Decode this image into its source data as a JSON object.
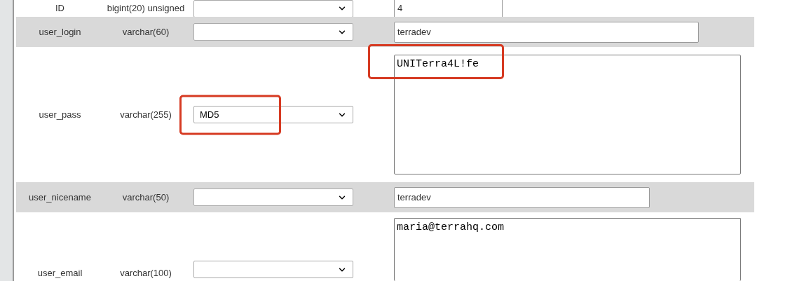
{
  "rows": [
    {
      "column": "ID",
      "type": "bigint(20) unsigned",
      "value": "4",
      "kind": "input",
      "shaded": false,
      "highlight_function": false,
      "highlight_value": false
    },
    {
      "column": "user_login",
      "type": "varchar(60)",
      "value": "terradev",
      "kind": "input",
      "shaded": true,
      "highlight_function": false,
      "highlight_value": false
    },
    {
      "column": "user_pass",
      "type": "varchar(255)",
      "function": "MD5",
      "value": "UNITerra4L!fe",
      "kind": "textarea",
      "shaded": false,
      "highlight_function": true,
      "highlight_value": true
    },
    {
      "column": "user_nicename",
      "type": "varchar(50)",
      "value": "terradev",
      "kind": "input",
      "shaded": true,
      "highlight_function": false,
      "highlight_value": false
    },
    {
      "column": "user_email",
      "type": "varchar(100)",
      "value": "maria@terrahq.com",
      "kind": "textarea",
      "shaded": false,
      "highlight_function": false,
      "highlight_value": false
    }
  ]
}
